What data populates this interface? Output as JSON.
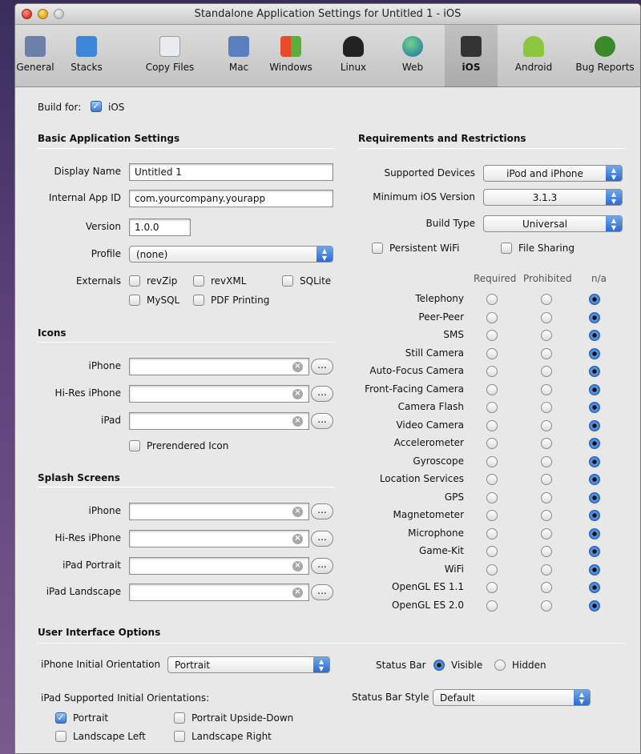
{
  "window": {
    "title": "Standalone Application Settings for Untitled 1 - iOS"
  },
  "toolbar": {
    "items": [
      {
        "label": "General",
        "icon": "general-icon",
        "color": "#6b7fa8"
      },
      {
        "label": "Stacks",
        "icon": "stacks-icon",
        "color": "#3d86d8"
      },
      {
        "label": "Copy Files",
        "icon": "copy-files-icon",
        "color": "#9aa0a8"
      },
      {
        "label": "Mac",
        "icon": "mac-icon",
        "color": "#5a7fbf"
      },
      {
        "label": "Windows",
        "icon": "windows-icon",
        "color": "#e8a020"
      },
      {
        "label": "Linux",
        "icon": "linux-icon",
        "color": "#222222"
      },
      {
        "label": "Web",
        "icon": "web-icon",
        "color": "#2e8b57"
      },
      {
        "label": "iOS",
        "icon": "ios-icon",
        "color": "#333333"
      },
      {
        "label": "Android",
        "icon": "android-icon",
        "color": "#8cc63f"
      },
      {
        "label": "Bug Reports",
        "icon": "bug-icon",
        "color": "#3a8a2a"
      }
    ],
    "selected": "iOS"
  },
  "build_for": {
    "label": "Build for:",
    "checkbox_label": "iOS",
    "checked": true
  },
  "basic": {
    "title": "Basic Application Settings",
    "display_name_label": "Display Name",
    "display_name": "Untitled 1",
    "app_id_label": "Internal App ID",
    "app_id": "com.yourcompany.yourapp",
    "version_label": "Version",
    "version": "1.0.0",
    "profile_label": "Profile",
    "profile": "(none)",
    "externals_label": "Externals",
    "externals": [
      "revZip",
      "revXML",
      "SQLite",
      "MySQL",
      "PDF Printing"
    ]
  },
  "icons": {
    "title": "Icons",
    "rows": [
      "iPhone",
      "Hi-Res iPhone",
      "iPad"
    ],
    "prerendered_label": "Prerendered Icon",
    "browse_label": "..."
  },
  "splash": {
    "title": "Splash Screens",
    "rows": [
      "iPhone",
      "Hi-Res iPhone",
      "iPad Portrait",
      "iPad Landscape"
    ],
    "browse_label": "..."
  },
  "req": {
    "title": "Requirements and Restrictions",
    "devices_label": "Supported Devices",
    "devices": "iPod and iPhone",
    "min_ios_label": "Minimum iOS Version",
    "min_ios": "3.1.3",
    "build_type_label": "Build Type",
    "build_type": "Universal",
    "persistent_wifi": "Persistent WiFi",
    "file_sharing": "File Sharing",
    "col_required": "Required",
    "col_prohibited": "Prohibited",
    "col_na": "n/a",
    "capabilities": [
      "Telephony",
      "Peer-Peer",
      "SMS",
      "Still Camera",
      "Auto-Focus Camera",
      "Front-Facing Camera",
      "Camera Flash",
      "Video Camera",
      "Accelerometer",
      "Gyroscope",
      "Location Services",
      "GPS",
      "Magnetometer",
      "Microphone",
      "Game-Kit",
      "WiFi",
      "OpenGL ES 1.1",
      "OpenGL ES 2.0"
    ]
  },
  "ui": {
    "title": "User Interface Options",
    "iphone_orient_label": "iPhone Initial Orientation",
    "iphone_orient": "Portrait",
    "status_bar_label": "Status Bar",
    "status_visible": "Visible",
    "status_hidden": "Hidden",
    "ipad_orient_label": "iPad Supported Initial Orientations:",
    "status_style_label": "Status Bar Style",
    "status_style": "Default",
    "orientations": [
      "Portrait",
      "Portrait Upside-Down",
      "Landscape Left",
      "Landscape Right"
    ]
  }
}
